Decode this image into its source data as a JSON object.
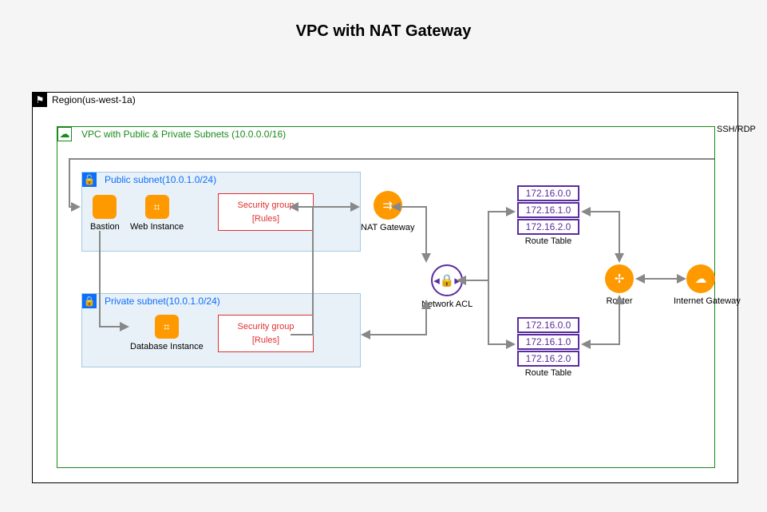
{
  "title": "VPC with NAT Gateway",
  "region": {
    "label": "Region(us-west-1a)"
  },
  "vpc": {
    "label": "VPC with Public & Private Subnets (10.0.0.0/16)"
  },
  "ssh_label": "SSH/RDP",
  "public_subnet": {
    "label": "Public subnet(10.0.1.0/24)",
    "bastion": "Bastion",
    "web": "Web Instance",
    "nat": "NAT Gateway",
    "secgroup_title": "Security group",
    "secgroup_rules": "[Rules]"
  },
  "private_subnet": {
    "label": "Private subnet(10.0.1.0/24)",
    "db": "Database Instance",
    "secgroup_title": "Security group",
    "secgroup_rules": "[Rules]"
  },
  "network_acl": "Network ACL",
  "router": "Router",
  "igw": "Internet Gateway",
  "route_table_label": "Route Table",
  "route_table_1": {
    "r1": "172.16.0.0",
    "r2": "172.16.1.0",
    "r3": "172.16.2.0"
  },
  "route_table_2": {
    "r1": "172.16.0.0",
    "r2": "172.16.1.0",
    "r3": "172.16.2.0"
  }
}
